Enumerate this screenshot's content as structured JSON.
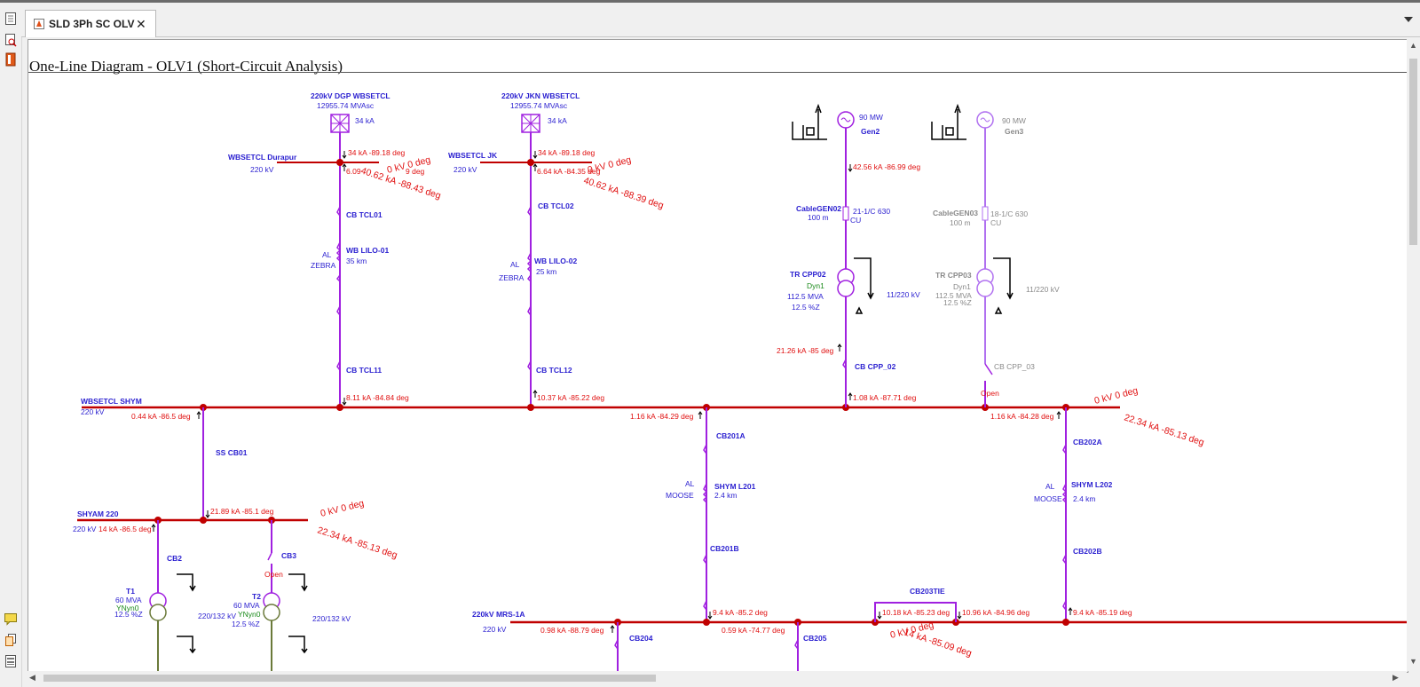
{
  "tab": {
    "title": "SLD 3Ph SC OLV",
    "close": "✕"
  },
  "diagram_title": "One-Line Diagram   -   OLV1 (Short-Circuit Analysis)",
  "icons": [
    "page-icon",
    "search-report-icon",
    "book-icon",
    "comment-icon",
    "copy-icon",
    "list-icon",
    "chevron-down-icon",
    "close-icon"
  ],
  "colors": {
    "bus": "#c00000",
    "branch": "#a020e0",
    "label": "#2a1fd0",
    "result": "#e01010",
    "grey": "#8a8a8a",
    "green": "#1a8a1a",
    "tan": "#6b7a3a"
  },
  "labels": {
    "dgp_name": "220kV DGP WBSETCL",
    "dgp_mva": "12955.74 MVAsc",
    "dgp_ka": "34 kA",
    "jkn_name": "220kV JKN WBSETCL",
    "jkn_mva": "12955.74 MVAsc",
    "jkn_ka": "34 kA",
    "durapur": "WBSETCL Durapur",
    "durapur_kv": "220 kV",
    "jk": "WBSETCL JK",
    "jk_kv": "220 kV",
    "r1": "34 kA -89.18 deg",
    "r2": "6.09",
    "r3": "0 kV 0 deg",
    "r4": "40.62 kA -88.43 deg",
    "r2b": "9 deg",
    "r5": "34 kA -89.18 deg",
    "r6": "6.64 kA -84.35 deg",
    "r7": "0 kV 0 deg",
    "r8": "40.62 kA -88.39 deg",
    "cb_tcl01": "CB TCL01",
    "cb_tcl02": "CB TCL02",
    "al1": "AL",
    "zebra1": "ZEBRA",
    "lilo01": "WB LILO-01",
    "lilo01_km": "35 km",
    "al2": "AL",
    "zebra2": "ZEBRA",
    "lilo02": "WB LILO-02",
    "lilo02_km": "25 km",
    "cb_tcl11": "CB TCL11",
    "cb_tcl12": "CB TCL12",
    "r9": "8.11 kA -84.84 deg",
    "r10": "10.37 kA -85.22 deg",
    "gen2_mw": "90 MW",
    "gen2": "Gen2",
    "gen3_mw": "90 MW",
    "gen3": "Gen3",
    "r11": "42.56 kA -86.99 deg",
    "cablegen02": "CableGEN02",
    "cablegen02_len": "100 m",
    "cable02_spec": "21-1/C 630",
    "cable02_cu": "CU",
    "cablegen03": "CableGEN03",
    "cablegen03_len": "100 m",
    "cable03_spec": "18-1/C 630",
    "cable03_cu": "CU",
    "tr_cpp02": "TR CPP02",
    "tr02_dyn": "Dyn1",
    "tr02_mva": "112.5 MVA",
    "tr02_z": "12.5 %Z",
    "tr02_kv": "11/220 kV",
    "tr_cpp03": "TR CPP03",
    "tr03_dyn": "Dyn1",
    "tr03_mva": "112.5 MVA",
    "tr03_z": "12.5 %Z",
    "tr03_kv": "11/220 kV",
    "r12": "21.26 kA -85 deg",
    "cb_cpp02": "CB CPP_02",
    "cb_cpp03": "CB CPP_03",
    "open1": "Open",
    "r13": "1.08 kA -87.71 deg",
    "shym_bus": "WBSETCL SHYM",
    "shym_kv": "220 kV",
    "r14": "0.44 kA -86.5 deg",
    "r15": "1.16 kA -84.29 deg",
    "r16": "1.16 kA -84.28 deg",
    "r17": "0 kV 0 deg",
    "r18": "22.34 kA -85.13 deg",
    "ss_cb01": "SS CB01",
    "cb201a": "CB201A",
    "cb202a": "CB202A",
    "al3": "AL",
    "moose3": "MOOSE",
    "shym_l201": "SHYM L201",
    "l201_km": "2.4 km",
    "al4": "AL",
    "moose4": "MOOSE",
    "shym_l202": "SHYM L202",
    "l202_km": "2.4 km",
    "shyam220": "SHYAM 220",
    "shyam_kv": "220 kV",
    "r19": "14 kA -86.5 deg",
    "r20": "21.89 kA -85.1 deg",
    "r21": "0 kV 0 deg",
    "r22": "22.34 kA -85.13 deg",
    "cb2": "CB2",
    "cb3": "CB3",
    "open2": "Open",
    "t1": "T1",
    "t1_mva": "60 MVA",
    "t1_vec": "YNyn0",
    "t1_z": "12.5 %Z",
    "t1_kv": "220/132 kV",
    "t2": "T2",
    "t2_mva": "60 MVA",
    "t2_vec": "YNyn0",
    "t2_z": "12.5 %Z",
    "t2_kv": "220/132 kV",
    "cb201b": "CB201B",
    "cb202b": "CB202B",
    "cb203tie": "CB203TIE",
    "mrs_bus": "220kV MRS-1A",
    "mrs_kv": "220 kV",
    "r23": "0.98 kA -88.79 deg",
    "r24": "9.4 kA -85.2 deg",
    "r25": "0.59 kA -74.77 deg",
    "r26": "10.18 kA -85.23 deg",
    "r27": "10.96 kA -84.96 deg",
    "r28": "9.4 kA -85.19 deg",
    "r29": "0 kV 0 deg",
    "r30": "14 kA -85.09 deg",
    "cb204": "CB204",
    "cb205": "CB205"
  }
}
